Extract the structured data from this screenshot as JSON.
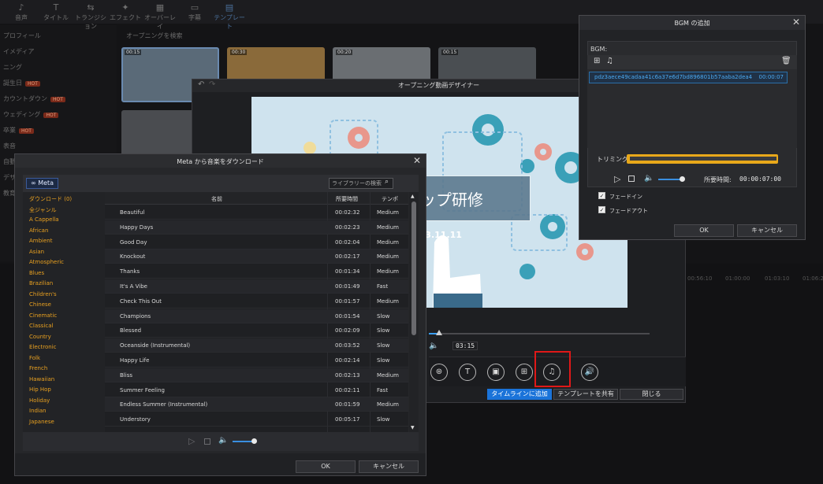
{
  "background_app": {
    "tabs": [
      {
        "label": "音声",
        "icon": "music-note-icon"
      },
      {
        "label": "タイトル",
        "icon": "text-icon"
      },
      {
        "label": "トランジション",
        "icon": "transition-icon"
      },
      {
        "label": "エフェクト",
        "icon": "effect-icon"
      },
      {
        "label": "オーバーレイ",
        "icon": "overlay-icon"
      },
      {
        "label": "字幕",
        "icon": "subtitle-icon"
      },
      {
        "label": "テンプレート",
        "icon": "template-icon"
      }
    ],
    "sidebar": [
      {
        "label": "プロフィール",
        "hot": false
      },
      {
        "label": "イメディア",
        "hot": false
      },
      {
        "label": "ニング",
        "hot": false
      },
      {
        "label": "誕生日",
        "hot": true
      },
      {
        "label": "カウントダウン",
        "hot": true
      },
      {
        "label": "ウェディング",
        "hot": true
      },
      {
        "label": "卒業",
        "hot": true
      },
      {
        "label": "表音",
        "hot": false
      },
      {
        "label": "自動",
        "hot": false
      },
      {
        "label": "デザ",
        "hot": false
      },
      {
        "label": "教育",
        "hot": false
      }
    ],
    "hot_badge": "HOT",
    "search_label": "オープニングを検索",
    "thumb_labels": [
      "00:15",
      "00:30",
      "00:20",
      "00:15"
    ],
    "timeline_times": [
      "00:56:10",
      "01:00:00",
      "01:03:10",
      "01:06:20"
    ]
  },
  "designer": {
    "title": "オープニング動画デザイナー",
    "title_text": "アップ研修",
    "date_text": "023.11.11",
    "time_display": "03:15",
    "buttons": {
      "add_to_timeline": "タイムラインに追加",
      "share_template": "テンプレートを共有",
      "close": "閉じる"
    },
    "tools": [
      "group-icon",
      "text-icon",
      "image-icon",
      "media-icon",
      "music-icon",
      "volume-icon"
    ],
    "colors": {
      "highlight": "#e01818",
      "accent": "#1a73d9"
    }
  },
  "bgm": {
    "title": "BGM の追加",
    "label": "BGM:",
    "file_name": "pdz3aece49cadaa41c6a37e6d7bd896801b57aaba2dea4437...",
    "file_time": "00:00:07",
    "trim_label": "トリミング",
    "duration_label": "所要時間:",
    "duration_value": "00:00:07:00",
    "fade_in": "フェードイン",
    "fade_out": "フェードアウト",
    "ok": "OK",
    "cancel": "キャンセル"
  },
  "meta_dialog": {
    "title": "Meta から音楽をダウンロード",
    "logo": "Meta",
    "search_placeholder": "ライブラリーの検索",
    "genres": [
      "ダウンロード (0)",
      "全ジャンル",
      "A Cappella",
      "African",
      "Ambient",
      "Asian",
      "Atmospheric",
      "Blues",
      "Brazilian",
      "Children's",
      "Chinese",
      "Cinematic",
      "Classical",
      "Country",
      "Electronic",
      "Folk",
      "French",
      "Hawaiian",
      "Hip Hop",
      "Holiday",
      "Indian",
      "Japanese"
    ],
    "columns": {
      "name": "名前",
      "duration": "所要時間",
      "tempo": "テンポ"
    },
    "tracks": [
      {
        "name": "Beautiful",
        "duration": "00:02:32",
        "tempo": "Medium"
      },
      {
        "name": "Happy Days",
        "duration": "00:02:23",
        "tempo": "Medium"
      },
      {
        "name": "Good Day",
        "duration": "00:02:04",
        "tempo": "Medium"
      },
      {
        "name": "Knockout",
        "duration": "00:02:17",
        "tempo": "Medium"
      },
      {
        "name": "Thanks",
        "duration": "00:01:34",
        "tempo": "Medium"
      },
      {
        "name": "It's A Vibe",
        "duration": "00:01:49",
        "tempo": "Fast"
      },
      {
        "name": "Check This Out",
        "duration": "00:01:57",
        "tempo": "Medium"
      },
      {
        "name": "Champions",
        "duration": "00:01:54",
        "tempo": "Slow"
      },
      {
        "name": "Blessed",
        "duration": "00:02:09",
        "tempo": "Slow"
      },
      {
        "name": "Oceanside (Instrumental)",
        "duration": "00:03:52",
        "tempo": "Slow"
      },
      {
        "name": "Happy Life",
        "duration": "00:02:14",
        "tempo": "Slow"
      },
      {
        "name": "Bliss",
        "duration": "00:02:13",
        "tempo": "Medium"
      },
      {
        "name": "Summer Feeling",
        "duration": "00:02:11",
        "tempo": "Fast"
      },
      {
        "name": "Endless Summer (Instrumental)",
        "duration": "00:01:59",
        "tempo": "Medium"
      },
      {
        "name": "Understory",
        "duration": "00:05:17",
        "tempo": "Slow"
      }
    ],
    "ok": "OK",
    "cancel": "キャンセル"
  }
}
